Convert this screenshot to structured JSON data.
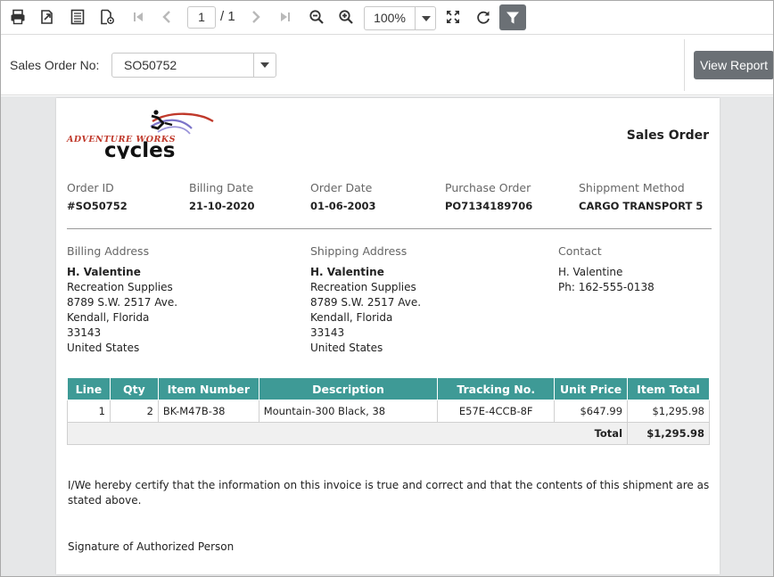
{
  "toolbar": {
    "page_current": "1",
    "page_total": "/ 1",
    "zoom": "100%"
  },
  "params": {
    "label": "Sales Order No:",
    "value": "SO50752",
    "view_report": "View Report"
  },
  "report": {
    "logo_text_top": "ADVENTURE WORKS",
    "logo_text_main": "cycles",
    "title": "Sales Order",
    "meta": [
      {
        "label": "Order ID",
        "value": "#SO50752"
      },
      {
        "label": "Billing Date",
        "value": "21-10-2020"
      },
      {
        "label": "Order Date",
        "value": "01-06-2003"
      },
      {
        "label": "Purchase Order",
        "value": "PO7134189706"
      },
      {
        "label": "Shippment Method",
        "value": "CARGO TRANSPORT 5"
      }
    ],
    "billing": {
      "label": "Billing Address",
      "name": "H. Valentine",
      "line1": "Recreation Supplies",
      "line2": "8789 S.W. 2517 Ave.",
      "line3": "Kendall, Florida",
      "line4": "33143",
      "line5": "United States"
    },
    "shipping": {
      "label": "Shipping Address",
      "name": "H. Valentine",
      "line1": "Recreation Supplies",
      "line2": "8789 S.W. 2517 Ave.",
      "line3": "Kendall, Florida",
      "line4": "33143",
      "line5": "United States"
    },
    "contact": {
      "label": "Contact",
      "name": "H. Valentine",
      "phone": "Ph: 162-555-0138"
    },
    "table": {
      "headers": [
        "Line",
        "Qty",
        "Item Number",
        "Description",
        "Tracking No.",
        "Unit Price",
        "Item Total"
      ],
      "rows": [
        [
          "1",
          "2",
          "BK-M47B-38",
          "Mountain-300 Black, 38",
          "E57E-4CCB-8F",
          "$647.99",
          "$1,295.98"
        ]
      ],
      "total_label": "Total",
      "total_value": "$1,295.98"
    },
    "certify": "I/We hereby certify that the information on this invoice is true and correct and that the contents of this shipment are as stated above.",
    "signature": "Signature of Authorized Person"
  },
  "colors": {
    "table_header": "#3e9a96",
    "button_dark": "#6b7075",
    "viewer_bg": "#e6e7e8"
  }
}
